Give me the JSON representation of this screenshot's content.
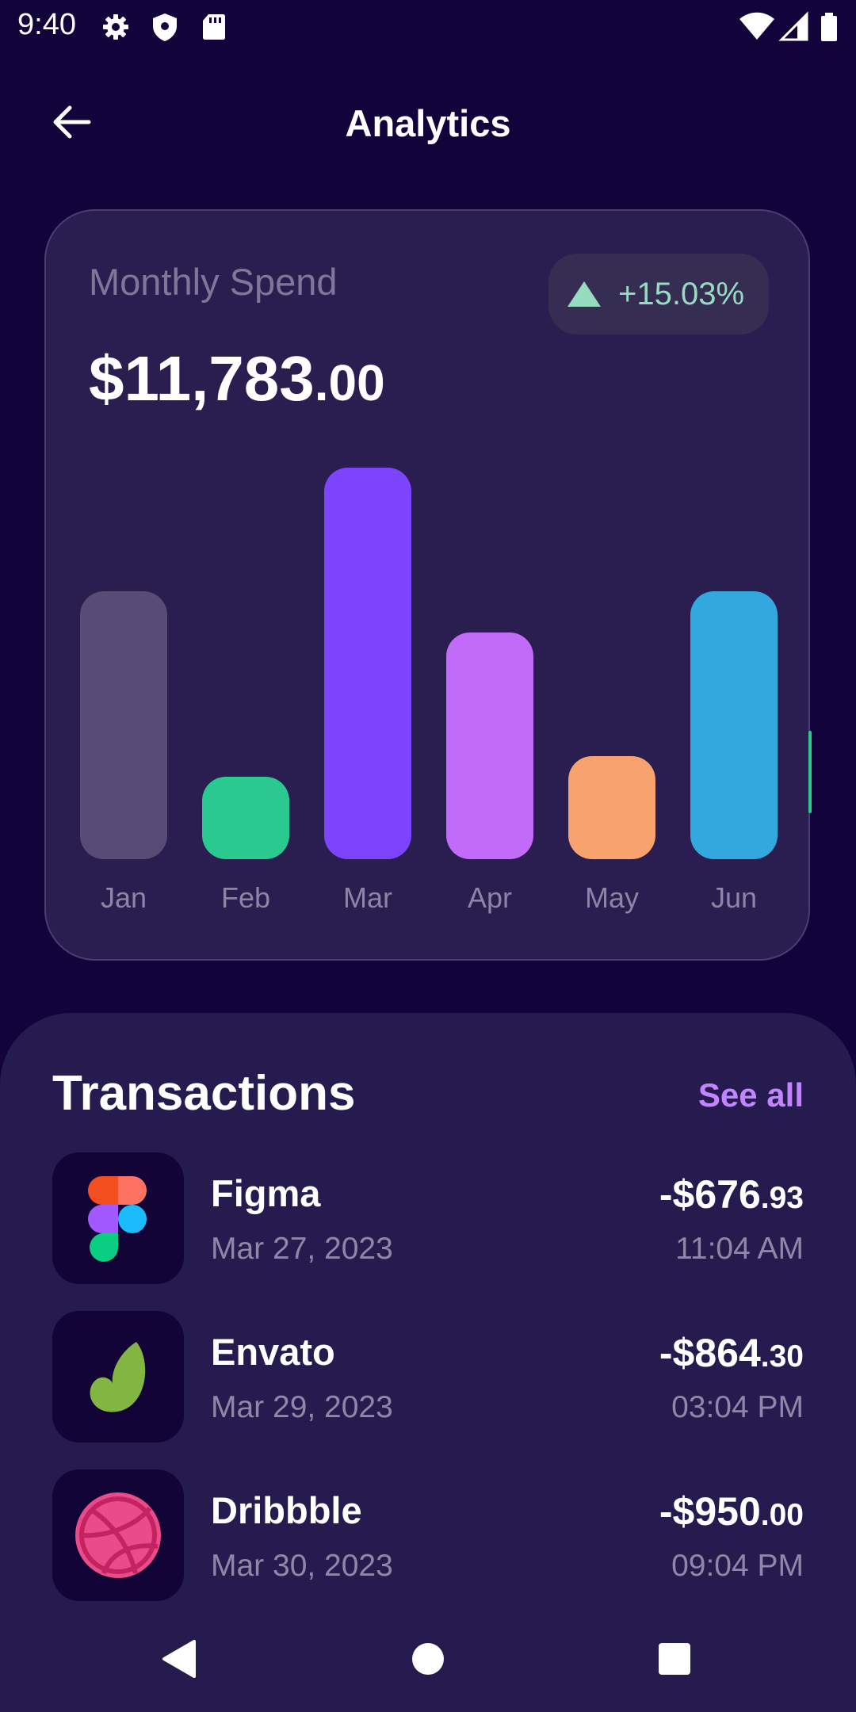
{
  "status_bar": {
    "time": "9:40",
    "left_icons": [
      "gear-icon",
      "shield-icon",
      "sd-card-icon"
    ],
    "right_icons": [
      "wifi-icon",
      "cell-signal-icon",
      "battery-icon"
    ]
  },
  "header": {
    "back_icon": "arrow-left-icon",
    "title": "Analytics"
  },
  "spend_card": {
    "label": "Monthly Spend",
    "amount_main": "$11,783",
    "amount_cents": ".00",
    "change": {
      "icon": "triangle-up-icon",
      "value": "+15.03%",
      "color": "#97dcc1"
    }
  },
  "chart_data": {
    "type": "bar",
    "categories": [
      "Jan",
      "Feb",
      "Mar",
      "Apr",
      "May",
      "Jun"
    ],
    "values": [
      6.5,
      2.0,
      9.5,
      5.5,
      2.5,
      6.5
    ],
    "colors": [
      "#584c76",
      "#2ac98f",
      "#7c44fd",
      "#c26bf9",
      "#f8a26d",
      "#32a8de"
    ],
    "title": "",
    "xlabel": "",
    "ylabel": "",
    "ylim": [
      0,
      10
    ],
    "grid": false
  },
  "transactions": {
    "title": "Transactions",
    "see_all": "See all",
    "items": [
      {
        "name": "Figma",
        "date": "Mar 27, 2023",
        "amount_main": "-$676",
        "amount_cents": ".93",
        "time": "11:04 AM",
        "icon": "figma-icon"
      },
      {
        "name": "Envato",
        "date": "Mar 29, 2023",
        "amount_main": "-$864",
        "amount_cents": ".30",
        "time": "03:04 PM",
        "icon": "envato-icon"
      },
      {
        "name": "Dribbble",
        "date": "Mar 30, 2023",
        "amount_main": "-$950",
        "amount_cents": ".00",
        "time": "09:04 PM",
        "icon": "dribbble-icon"
      }
    ]
  },
  "nav_bar": {
    "icons": [
      "back-triangle-icon",
      "home-circle-icon",
      "recents-square-icon"
    ]
  }
}
